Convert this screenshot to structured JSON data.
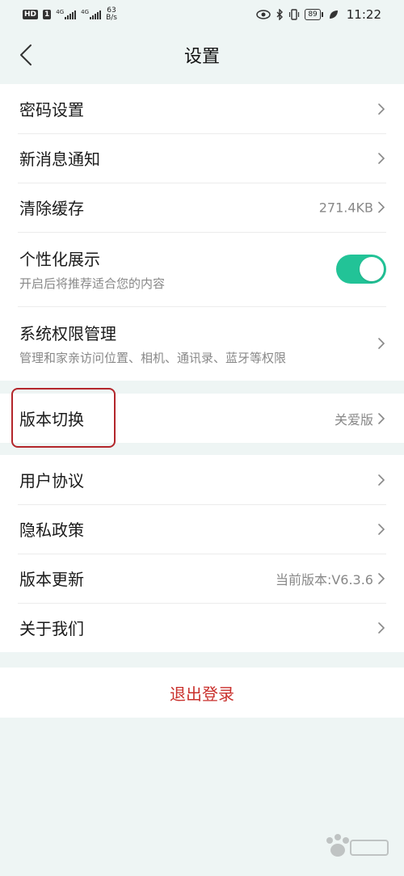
{
  "status_bar": {
    "hd": "HD",
    "sim": "1",
    "sig1": "4G",
    "sig2": "4G",
    "speed_value": "63",
    "speed_unit": "B/s",
    "battery": "89",
    "time": "11:22"
  },
  "nav": {
    "title": "设置"
  },
  "group1": {
    "items": [
      {
        "label": "密码设置"
      },
      {
        "label": "新消息通知"
      },
      {
        "label": "清除缓存",
        "value": "271.4KB"
      },
      {
        "label": "个性化展示",
        "sub": "开启后将推荐适合您的内容",
        "toggle_on": true
      },
      {
        "label": "系统权限管理",
        "sub": "管理和家亲访问位置、相机、通讯录、蓝牙等权限"
      }
    ]
  },
  "group2": {
    "items": [
      {
        "label": "版本切换",
        "value": "关爱版"
      }
    ]
  },
  "group3": {
    "items": [
      {
        "label": "用户协议"
      },
      {
        "label": "隐私政策"
      },
      {
        "label": "版本更新",
        "value": "当前版本:V6.3.6"
      },
      {
        "label": "关于我们"
      }
    ]
  },
  "logout": {
    "label": "退出登录"
  },
  "colors": {
    "accent_toggle": "#22c397",
    "logout_red": "#c9302c",
    "highlight_red": "#b3262b",
    "background": "#eef5f4"
  },
  "icons": {
    "back": "chevron-left-icon",
    "row_arrow": "chevron-right-icon"
  }
}
